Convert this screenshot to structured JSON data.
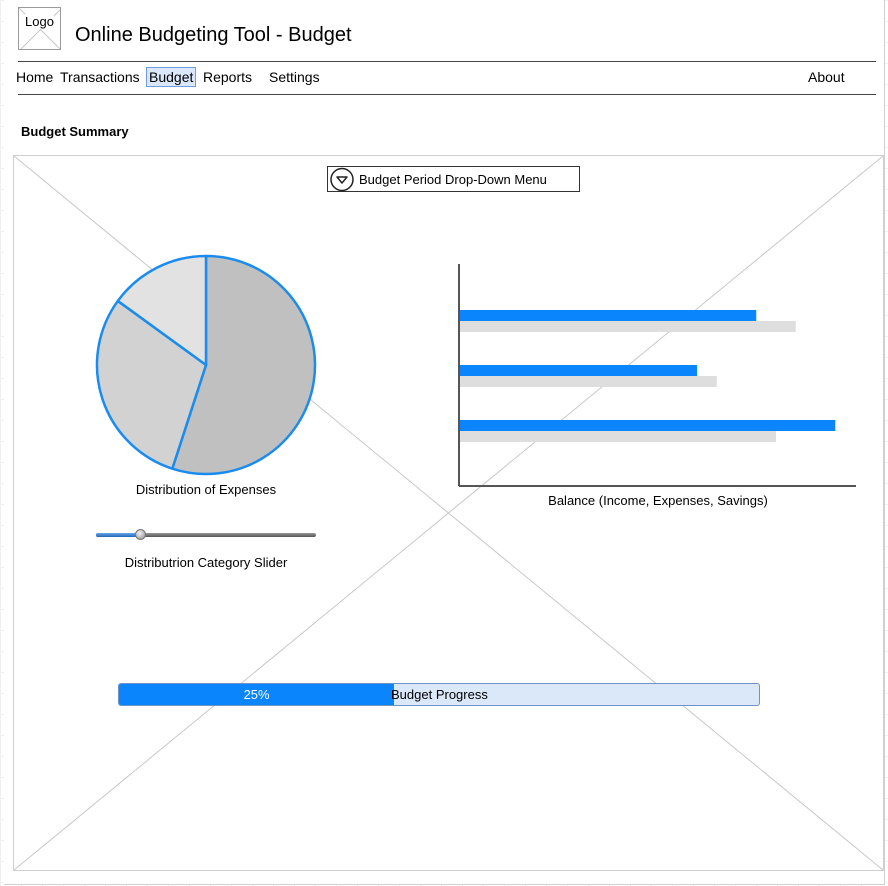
{
  "header": {
    "logo_label": "Logo",
    "title": "Online Budgeting Tool - Budget"
  },
  "nav": {
    "items": [
      {
        "label": "Home",
        "active": false
      },
      {
        "label": "Transactions",
        "active": false
      },
      {
        "label": "Budget",
        "active": true
      },
      {
        "label": "Reports",
        "active": false
      },
      {
        "label": "Settings",
        "active": false
      }
    ],
    "about_label": "About"
  },
  "main": {
    "section_title": "Budget Summary",
    "dropdown_label": "Budget Period Drop-Down Menu",
    "pie_caption": "Distribution of Expenses",
    "bar_caption": "Balance (Income, Expenses, Savings)",
    "slider_caption": "Distributrion Category Slider",
    "slider_value": 0.2,
    "progress": {
      "percent_label": "25%",
      "label": "Budget Progress",
      "value": 0.43
    }
  },
  "chart_data": [
    {
      "type": "pie",
      "title": "",
      "slices": [
        {
          "value": 55
        },
        {
          "value": 30
        },
        {
          "value": 15
        }
      ],
      "colors": [
        "#c0c0c0",
        "#d2d2d2",
        "#e2e2e2"
      ],
      "stroke_color": "#1a8cf0"
    },
    {
      "type": "bar",
      "orientation": "horizontal",
      "xlim": [
        0,
        100
      ],
      "series": [
        {
          "values": [
            75,
            60,
            95
          ],
          "color": "#0a85fb"
        },
        {
          "values": [
            85,
            65,
            80
          ],
          "color": "#dedede"
        }
      ]
    }
  ]
}
